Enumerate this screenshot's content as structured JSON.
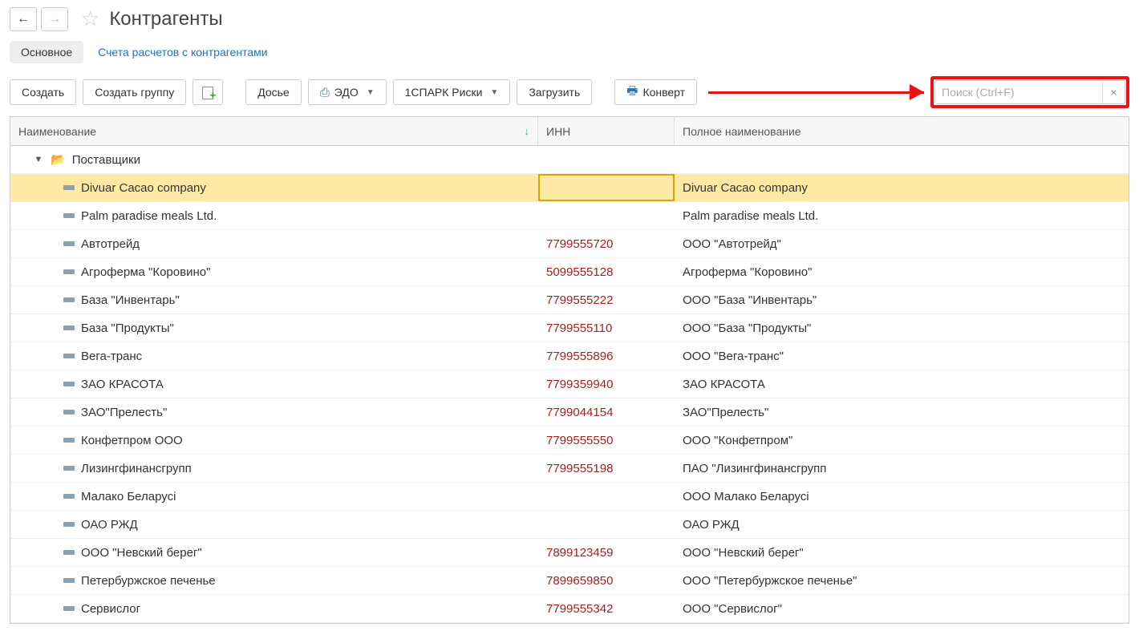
{
  "header": {
    "title": "Контрагенты"
  },
  "tabs": {
    "main": "Основное",
    "accounts": "Счета расчетов с контрагентами"
  },
  "toolbar": {
    "create": "Создать",
    "create_group": "Создать группу",
    "dossier": "Досье",
    "edo": "ЭДО",
    "spark": "1СПАРК Риски",
    "load": "Загрузить",
    "convert": "Конверт",
    "search_placeholder": "Поиск (Ctrl+F)"
  },
  "columns": {
    "name": "Наименование",
    "inn": "ИНН",
    "fullname": "Полное наименование"
  },
  "group": {
    "label": "Поставщики"
  },
  "rows": [
    {
      "name": "Divuar Cacao company",
      "inn": "",
      "full": "Divuar Cacao company",
      "selected": true
    },
    {
      "name": "Palm paradise meals Ltd.",
      "inn": "",
      "full": "Palm paradise meals Ltd."
    },
    {
      "name": "Автотрейд",
      "inn": "7799555720",
      "full": "ООО \"Автотрейд\""
    },
    {
      "name": "Агроферма \"Коровино\"",
      "inn": "5099555128",
      "full": "Агроферма \"Коровино\""
    },
    {
      "name": "База \"Инвентарь\"",
      "inn": "7799555222",
      "full": "ООО \"База \"Инвентарь\""
    },
    {
      "name": "База \"Продукты\"",
      "inn": "7799555110",
      "full": "ООО \"База \"Продукты\""
    },
    {
      "name": "Вега-транс",
      "inn": "7799555896",
      "full": "ООО \"Вега-транс\""
    },
    {
      "name": "ЗАО КРАСОТА",
      "inn": "7799359940",
      "full": "ЗАО КРАСОТА"
    },
    {
      "name": "ЗАО\"Прелесть\"",
      "inn": "7799044154",
      "full": "ЗАО\"Прелесть\""
    },
    {
      "name": "Конфетпром ООО",
      "inn": "7799555550",
      "full": "ООО \"Конфетпром\""
    },
    {
      "name": "Лизингфинансгрупп",
      "inn": "7799555198",
      "full": "ПАО \"Лизингфинансгрупп"
    },
    {
      "name": "Малако Беларусі",
      "inn": "",
      "full": "ООО Малако Беларусі"
    },
    {
      "name": "ОАО РЖД",
      "inn": "",
      "full": "ОАО РЖД"
    },
    {
      "name": "ООО \"Невский берег\"",
      "inn": "7899123459",
      "full": "ООО \"Невский берег\""
    },
    {
      "name": "Петербуржское печенье",
      "inn": "7899659850",
      "full": "ООО \"Петербуржское печенье\""
    },
    {
      "name": "Сервислог",
      "inn": "7799555342",
      "full": "ООО \"Сервислог\""
    }
  ]
}
